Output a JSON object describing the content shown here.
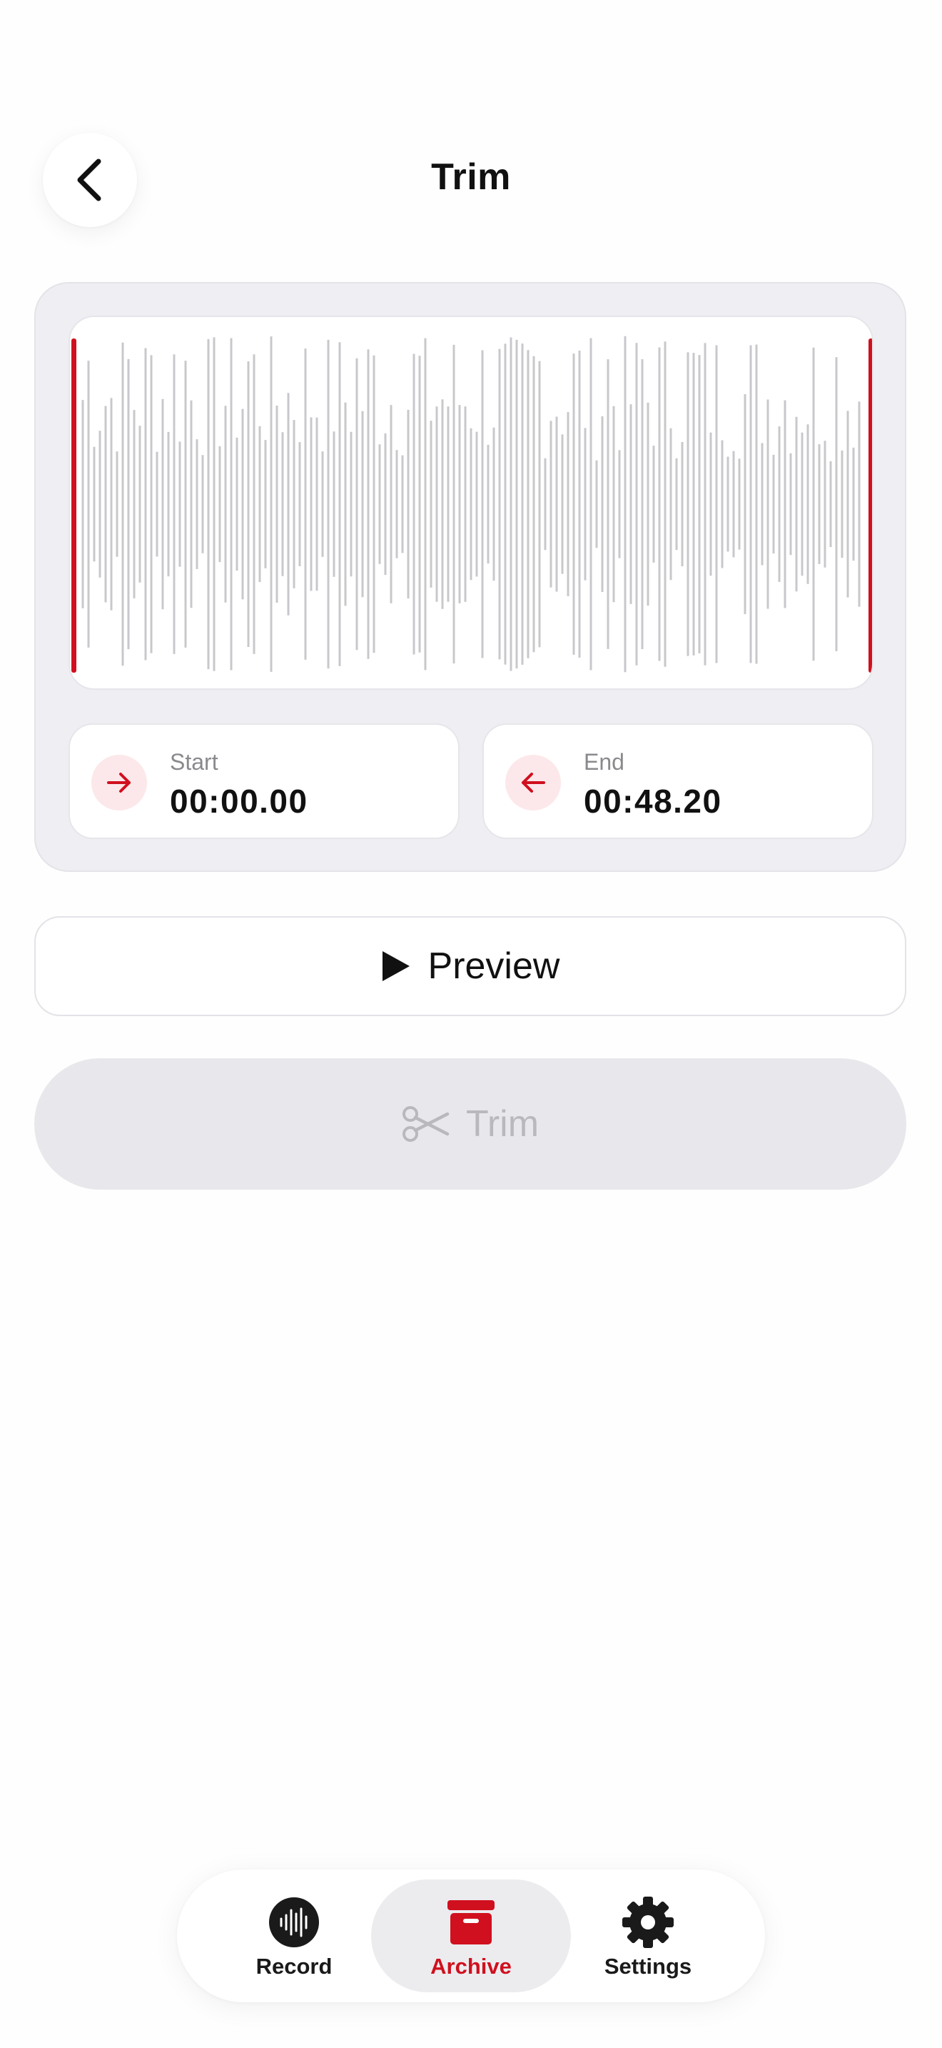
{
  "header": {
    "title": "Trim",
    "back_icon": "chevron-left-icon"
  },
  "waveform": {
    "start_handle_color": "#d0101e",
    "end_handle_color": "#d0101e",
    "bar_color": "#c8c8cc"
  },
  "range": {
    "start": {
      "label": "Start",
      "value": "00:00.00",
      "icon": "arrow-right-icon"
    },
    "end": {
      "label": "End",
      "value": "00:48.20",
      "icon": "arrow-left-icon"
    }
  },
  "actions": {
    "preview_label": "Preview",
    "preview_icon": "play-icon",
    "trim_label": "Trim",
    "trim_icon": "scissors-icon",
    "trim_enabled": false
  },
  "tabbar": {
    "items": [
      {
        "label": "Record",
        "icon": "waveform-icon",
        "active": false
      },
      {
        "label": "Archive",
        "icon": "archive-box-icon",
        "active": true
      },
      {
        "label": "Settings",
        "icon": "gear-icon",
        "active": false
      }
    ]
  },
  "colors": {
    "accent": "#d0101e",
    "accent_soft": "#fce8ea",
    "disabled": "#b9b9bd"
  }
}
